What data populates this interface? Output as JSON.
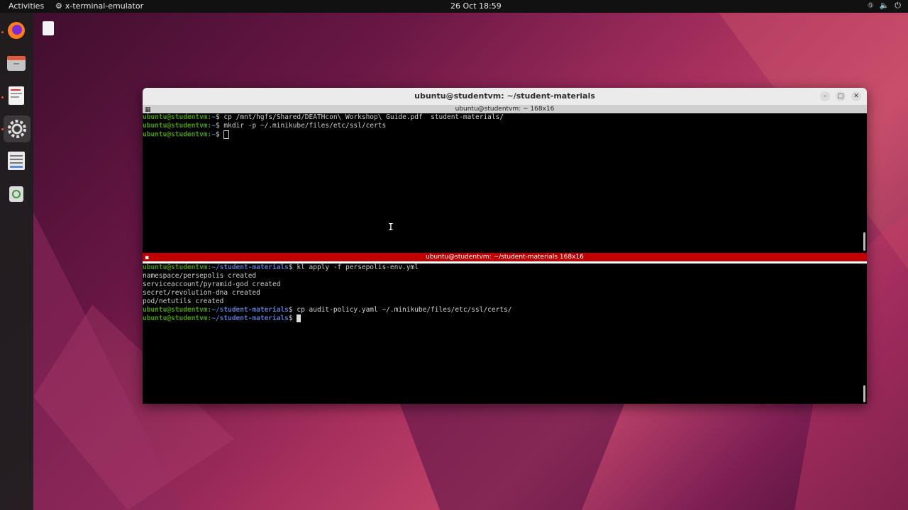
{
  "topbar": {
    "activities": "Activities",
    "app_name": "x-terminal-emulator",
    "clock": "26 Oct  18:59",
    "tray_icons": [
      "network-icon",
      "volume-icon",
      "power-icon"
    ]
  },
  "dock": {
    "items": [
      "firefox-icon",
      "files-icon",
      "text-editor-icon",
      "settings-icon",
      "document-viewer-icon",
      "trash-icon"
    ]
  },
  "window": {
    "title": "ubuntu@studentvm: ~/student-materials",
    "top_pane": {
      "bar_label": "ubuntu@studentvm: ~ 168x16",
      "lines": [
        {
          "user": "ubuntu@studentvm:",
          "path": "~",
          "cmd": "$ cp /mnt/hgfs/Shared/DEATHcon\\ Workshop\\ Guide.pdf  student-materials/"
        },
        {
          "user": "ubuntu@studentvm:",
          "path": "~",
          "cmd": "$ mkdir -p ~/.minikube/files/etc/ssl/certs"
        },
        {
          "user": "ubuntu@studentvm:",
          "path": "~",
          "cmd": "$ "
        }
      ]
    },
    "bottom_pane": {
      "bar_label": "ubuntu@studentvm: ~/student-materials 168x16",
      "lines": [
        {
          "user": "ubuntu@studentvm:",
          "path": "~/student-materials",
          "cmd": "$ kl apply -f persepolis-env.yml"
        },
        {
          "output": "namespace/persepolis created"
        },
        {
          "output": "serviceaccount/pyramid-god created"
        },
        {
          "output": "secret/revolution-dna created"
        },
        {
          "output": "pod/netutils created"
        },
        {
          "user": "ubuntu@studentvm:",
          "path": "~/student-materials",
          "cmd": "$ cp audit-policy.yaml ~/.minikube/files/etc/ssl/certs/"
        },
        {
          "user": "ubuntu@studentvm:",
          "path": "~/student-materials",
          "cmd": "$ "
        }
      ]
    }
  }
}
